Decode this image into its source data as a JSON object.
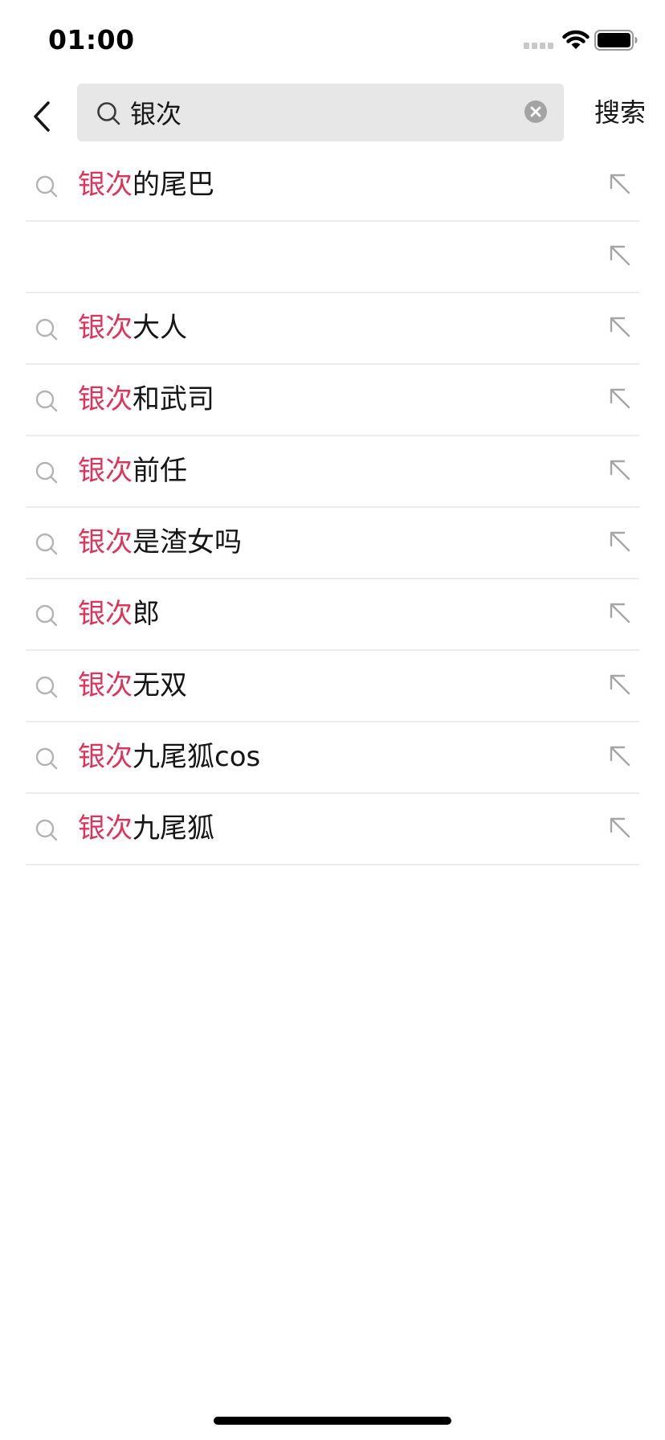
{
  "status_bar": {
    "time": "01:00",
    "signal_icon": "cellular-signal-icon",
    "wifi_icon": "wifi-icon",
    "battery_icon": "battery-icon"
  },
  "header": {
    "back_icon": "chevron-left-icon",
    "search_icon": "search-icon",
    "query": "银次",
    "clear_icon": "clear-circle-icon",
    "submit_label": "搜索"
  },
  "colors": {
    "highlight": "#e0335a",
    "search_box_bg": "#e7e7e7",
    "divider": "#ececec"
  },
  "suggestions": [
    {
      "highlight": "银次",
      "rest": "的尾巴"
    },
    {
      "highlight": "",
      "rest": ""
    },
    {
      "highlight": "银次",
      "rest": "大人"
    },
    {
      "highlight": "银次",
      "rest": "和武司"
    },
    {
      "highlight": "银次",
      "rest": "前任"
    },
    {
      "highlight": "银次",
      "rest": "是渣女吗"
    },
    {
      "highlight": "银次",
      "rest": "郎"
    },
    {
      "highlight": "银次",
      "rest": "无双"
    },
    {
      "highlight": "银次",
      "rest": "九尾狐cos"
    },
    {
      "highlight": "银次",
      "rest": "九尾狐"
    }
  ]
}
